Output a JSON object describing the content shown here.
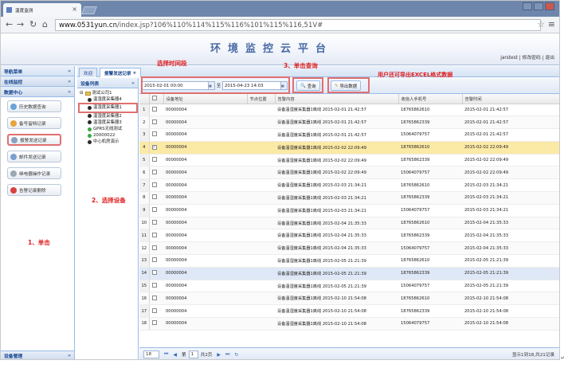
{
  "browser": {
    "tab_title": "温度监测",
    "url_host": "www.0531yun.cn",
    "url_path": "/index.jsp?106%110%114%115%116%101%115%116,51V#"
  },
  "header": {
    "title": "环境监控云平台",
    "user": "jarstest",
    "change_password": "修改密码",
    "logout": "退出"
  },
  "sidebar": {
    "nav_title": "导航菜单",
    "online_monitor": "在线监控",
    "data_center": "数据中心",
    "items": [
      {
        "label": "历史数据查询"
      },
      {
        "label": "备号留档记录"
      },
      {
        "label": "报警发送记录"
      },
      {
        "label": "邮件发送记录"
      },
      {
        "label": "继电器操作记录"
      },
      {
        "label": "告警记录删除"
      }
    ],
    "device_mgmt": "设备管理"
  },
  "tabs": [
    {
      "label": "欢迎"
    },
    {
      "label": "报警发送记录"
    }
  ],
  "device_tree": {
    "title": "设备列表",
    "root": "测试公司1",
    "nodes": [
      {
        "label": "温湿度采集器4"
      },
      {
        "label": "温湿度采集器1"
      },
      {
        "label": "温湿度采集器2"
      },
      {
        "label": "温湿度采集器3"
      },
      {
        "label": "GPRS无线测试"
      },
      {
        "label": "20000022"
      },
      {
        "label": "中心机房演示"
      }
    ]
  },
  "toolbar": {
    "start_date": "2015-02-01 00:00",
    "to_label": "至",
    "end_date": "2015-04-23 14:03",
    "query_button": "查询",
    "export_button": "导出数据"
  },
  "grid": {
    "columns": [
      "设备地址",
      "节点位置",
      "告警内容",
      "收信人手机号",
      "告警时间"
    ],
    "rows": [
      {
        "n": "1",
        "addr": "00000004",
        "node": "",
        "content": "设备温湿度采集器1离线 2015-02-01 21:42:57",
        "phone": "18765862610",
        "time": "2015-02-01 21:42:57"
      },
      {
        "n": "2",
        "addr": "00000004",
        "node": "",
        "content": "设备温湿度采集器1离线 2015-02-01 21:42:57",
        "phone": "18765862339",
        "time": "2015-02-01 21:42:57"
      },
      {
        "n": "3",
        "addr": "00000004",
        "node": "",
        "content": "设备温湿度采集器1离线 2015-02-01 21:42:57",
        "phone": "15064079757",
        "time": "2015-02-01 21:42:57"
      },
      {
        "n": "4",
        "addr": "00000004",
        "node": "",
        "content": "设备温湿度采集器1离线 2015-02-02 22:09:49",
        "phone": "18765862610",
        "time": "2015-02-02 22:09:49"
      },
      {
        "n": "5",
        "addr": "00000004",
        "node": "",
        "content": "设备温湿度采集器1离线 2015-02-02 22:09:49",
        "phone": "18765862339",
        "time": "2015-02-02 22:09:49"
      },
      {
        "n": "6",
        "addr": "00000004",
        "node": "",
        "content": "设备温湿度采集器1离线 2015-02-02 22:09:49",
        "phone": "15064079757",
        "time": "2015-02-02 22:09:49"
      },
      {
        "n": "7",
        "addr": "00000004",
        "node": "",
        "content": "设备温湿度采集器1离线 2015-02-03 21:34:21",
        "phone": "18765862610",
        "time": "2015-02-03 21:34:21"
      },
      {
        "n": "8",
        "addr": "00000004",
        "node": "",
        "content": "设备温湿度采集器1离线 2015-02-03 21:34:21",
        "phone": "18765862339",
        "time": "2015-02-03 21:34:21"
      },
      {
        "n": "9",
        "addr": "00000004",
        "node": "",
        "content": "设备温湿度采集器1离线 2015-02-03 21:34:21",
        "phone": "15064079757",
        "time": "2015-02-03 21:34:21"
      },
      {
        "n": "10",
        "addr": "00000004",
        "node": "",
        "content": "设备温湿度采集器1离线 2015-02-04 21:35:33",
        "phone": "18765862610",
        "time": "2015-02-04 21:35:33"
      },
      {
        "n": "11",
        "addr": "00000004",
        "node": "",
        "content": "设备温湿度采集器1离线 2015-02-04 21:35:33",
        "phone": "18765862339",
        "time": "2015-02-04 21:35:33"
      },
      {
        "n": "12",
        "addr": "00000004",
        "node": "",
        "content": "设备温湿度采集器1离线 2015-02-04 21:35:33",
        "phone": "15064079757",
        "time": "2015-02-04 21:35:33"
      },
      {
        "n": "13",
        "addr": "00000004",
        "node": "",
        "content": "设备温湿度采集器1离线 2015-02-05 21:21:39",
        "phone": "18765862610",
        "time": "2015-02-05 21:21:39"
      },
      {
        "n": "14",
        "addr": "00000004",
        "node": "",
        "content": "设备温湿度采集器1离线 2015-02-05 21:21:39",
        "phone": "18765862339",
        "time": "2015-02-05 21:21:39"
      },
      {
        "n": "15",
        "addr": "00000004",
        "node": "",
        "content": "设备温湿度采集器1离线 2015-02-05 21:21:39",
        "phone": "15064079757",
        "time": "2015-02-05 21:21:39"
      },
      {
        "n": "16",
        "addr": "00000004",
        "node": "",
        "content": "设备温湿度采集器1离线 2015-02-10 21:54:08",
        "phone": "18765862610",
        "time": "2015-02-10 21:54:08"
      },
      {
        "n": "17",
        "addr": "00000004",
        "node": "",
        "content": "设备温湿度采集器1离线 2015-02-10 21:54:08",
        "phone": "18765862339",
        "time": "2015-02-10 21:54:08"
      },
      {
        "n": "18",
        "addr": "00000004",
        "node": "",
        "content": "设备温湿度采集器1离线 2015-02-10 21:54:08",
        "phone": "15064079757",
        "time": "2015-02-10 21:54:08"
      }
    ]
  },
  "pager": {
    "page_size": "18",
    "page_prefix": "第",
    "page": "1",
    "page_total": "共2页",
    "info": "显示1到18,共21记录"
  },
  "annotations": {
    "select_time": "选择时间段",
    "click_query": "3、单击查询",
    "export_hint": "用户还可导出EXCEL格式数据",
    "select_device": "2、选择设备",
    "click": "1、单击"
  }
}
